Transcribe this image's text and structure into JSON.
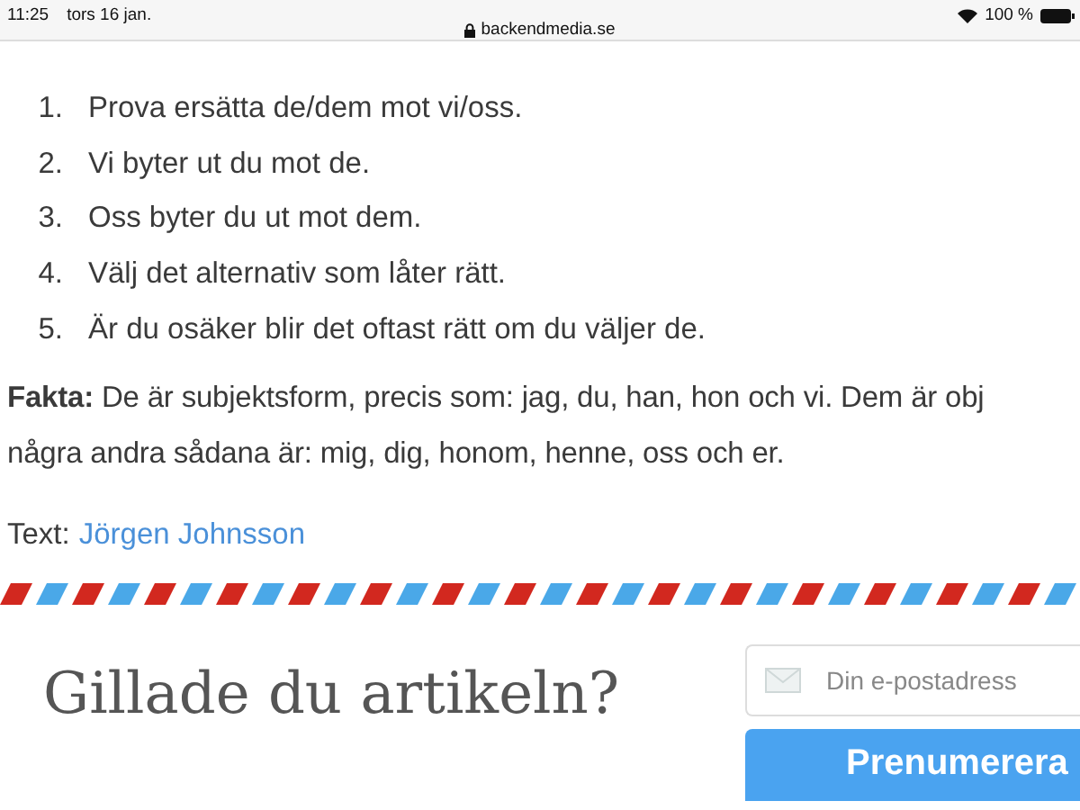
{
  "status_bar": {
    "time": "11:25",
    "date": "tors 16 jan.",
    "url": "backendmedia.se",
    "battery": "100 %"
  },
  "list": [
    "Prova ersätta de/dem mot vi/oss.",
    "Vi byter ut du mot de.",
    "Oss byter du ut mot dem.",
    "Välj det alternativ som låter rätt.",
    "Är du osäker blir det oftast rätt om du väljer de."
  ],
  "list_numbers": [
    "1.",
    "2.",
    "3.",
    "4.",
    "5."
  ],
  "fact_lines": [
    "**Fakta:** De är subjektsform, precis som: jag, du, han, hon och vi. Dem är obj",
    "några andra sådana är: mig, dig, honom, henne, oss och er."
  ],
  "byline": {
    "label": "Text:",
    "author": "Jörgen Johnsson"
  },
  "newsletter": {
    "heading": "Gillade du artikeln?",
    "email": {
      "placeholder": "Din e-postadress"
    },
    "button": "Prenumerera"
  }
}
